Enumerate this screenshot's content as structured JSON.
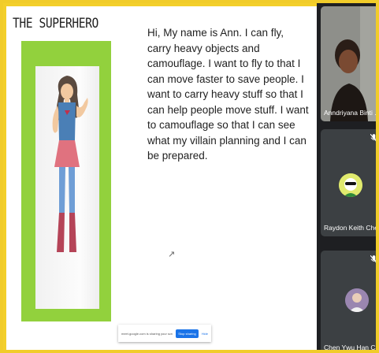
{
  "slide": {
    "title": "THE SUPERHERO",
    "body": "Hi, My name is Ann. I can fly, carry heavy objects and camouflage. I want to fly to that I can move faster to save people. I want to carry heavy stuff so that I can help people move stuff. I want to camouflage so that I can see what my villain planning and I can be prepared."
  },
  "share_bar": {
    "message": "meet.google.com is sharing your screen.",
    "stop_label": "Stop sharing",
    "hide_label": "Hide"
  },
  "participants": [
    {
      "name": "Anndriyana Binti ...",
      "muted": false
    },
    {
      "name": "Raydon Keith Chew",
      "muted": true
    },
    {
      "name": "Chen Ywu Han Cat...",
      "muted": true
    }
  ],
  "colors": {
    "border": "#f1cc2a",
    "slide_frame": "#92d13d",
    "tile_bg": "#3c4043",
    "sidebar_bg": "#1e1f22",
    "accent_blue": "#1a73e8"
  }
}
